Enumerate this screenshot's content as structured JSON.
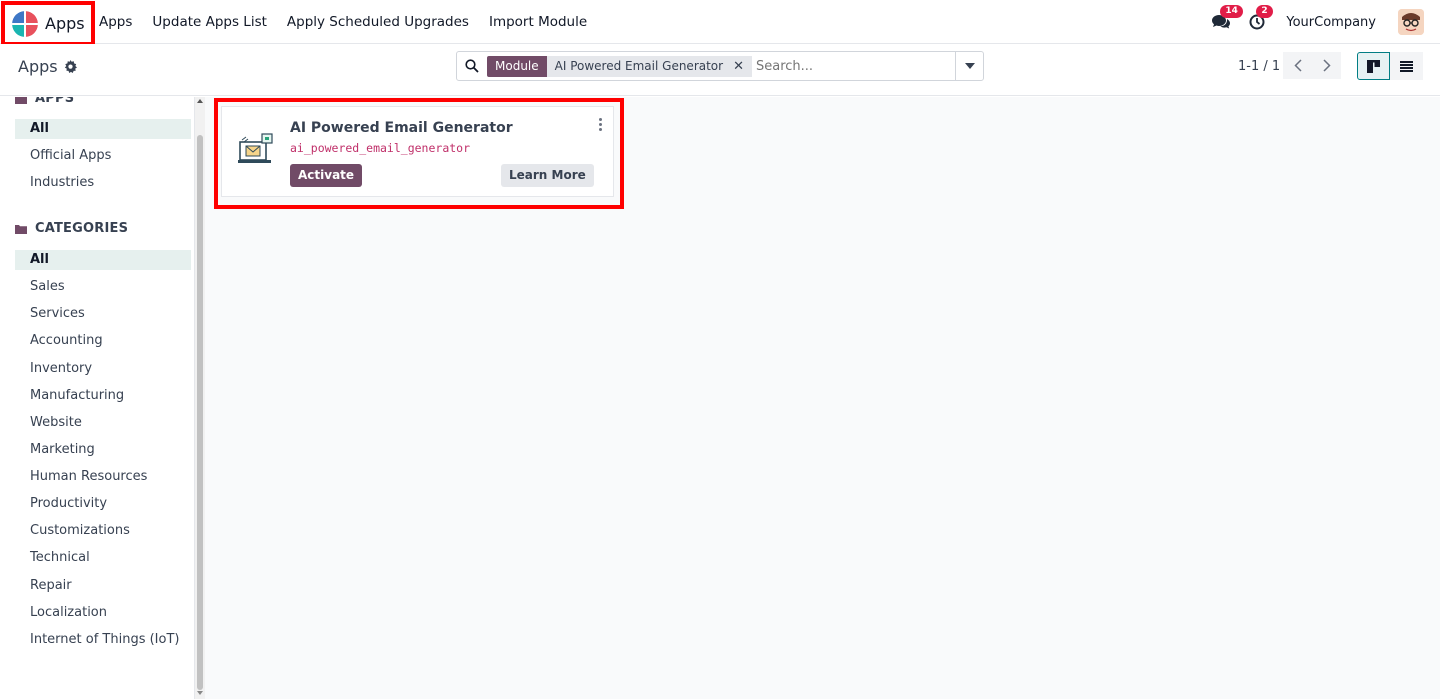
{
  "navbar": {
    "brand": "Apps",
    "menu": [
      "Apps",
      "Update Apps List",
      "Apply Scheduled Upgrades",
      "Import Module"
    ],
    "messages_count": "14",
    "activities_count": "2",
    "company": "YourCompany"
  },
  "control": {
    "breadcrumb": "Apps",
    "search": {
      "facet_label": "Module",
      "facet_value": "AI Powered Email Generator",
      "placeholder": "Search..."
    },
    "pager": "1-1 / 1"
  },
  "sidebar": {
    "apps_heading": "APPS",
    "apps_items": [
      "All",
      "Official Apps",
      "Industries"
    ],
    "categories_heading": "CATEGORIES",
    "category_items": [
      "All",
      "Sales",
      "Services",
      "Accounting",
      "Inventory",
      "Manufacturing",
      "Website",
      "Marketing",
      "Human Resources",
      "Productivity",
      "Customizations",
      "Technical",
      "Repair",
      "Localization",
      "Internet of Things (IoT)"
    ]
  },
  "card": {
    "title": "AI Powered Email Generator",
    "technical_name": "ai_powered_email_generator",
    "activate_label": "Activate",
    "learn_more_label": "Learn More"
  },
  "colors": {
    "primary": "#714b67",
    "highlight": "#ff0000",
    "badge": "#e11d48",
    "accent": "#017e84"
  }
}
